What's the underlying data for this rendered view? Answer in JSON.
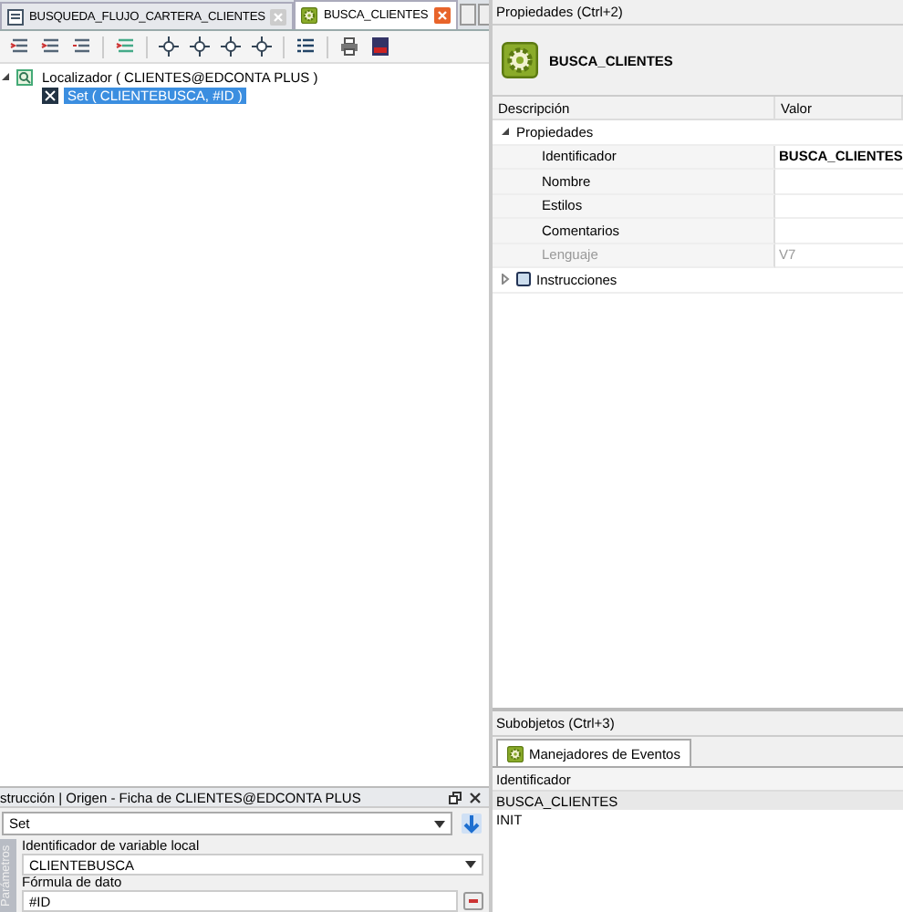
{
  "editor_tabs": [
    {
      "label": "BUSQUEDA_FLUJO_CARTERA_CLIENTES",
      "selected": false
    },
    {
      "label": "BUSCA_CLIENTES",
      "selected": true
    }
  ],
  "tree": [
    {
      "label": "Localizador ( CLIENTES@EDCONTA PLUS )",
      "kind": "locator",
      "selected": false,
      "expanded": true,
      "children": [
        {
          "label": "Set ( CLIENTEBUSCA, #ID )",
          "kind": "set",
          "selected": true
        }
      ]
    }
  ],
  "instruction_panel": {
    "title": "strucción | Origen - Ficha de CLIENTES@EDCONTA PLUS",
    "instruction": "Set",
    "side_label": "Parámetros",
    "fields": [
      {
        "label": "Identificador de variable local",
        "value": "CLIENTEBUSCA",
        "kind": "dropdown"
      },
      {
        "label": "Fórmula de dato",
        "value": "#ID",
        "kind": "formula"
      }
    ]
  },
  "properties": {
    "title": "Propiedades (Ctrl+2)",
    "object_name": "BUSCA_CLIENTES",
    "columns": [
      "Descripción",
      "Valor"
    ],
    "groups": [
      {
        "label": "Propiedades",
        "expanded": true,
        "rows": [
          {
            "label": "Identificador",
            "value": "BUSCA_CLIENTES",
            "disabled": false
          },
          {
            "label": "Nombre",
            "disabled": false
          },
          {
            "label": "Estilos",
            "disabled": false
          },
          {
            "label": "Comentarios",
            "disabled": false
          },
          {
            "label": "Lenguaje",
            "value": "V7",
            "disabled": true
          }
        ]
      },
      {
        "label": "Instrucciones",
        "expanded": false
      }
    ]
  },
  "subobjects": {
    "title": "Subobjetos (Ctrl+3)",
    "tabs": [
      {
        "label": "Manejadores de Eventos",
        "selected": true
      }
    ],
    "column": "Identificador",
    "rows": [
      {
        "label": "BUSCA_CLIENTES",
        "selected": true
      },
      {
        "label": "INIT",
        "selected": false
      }
    ]
  }
}
